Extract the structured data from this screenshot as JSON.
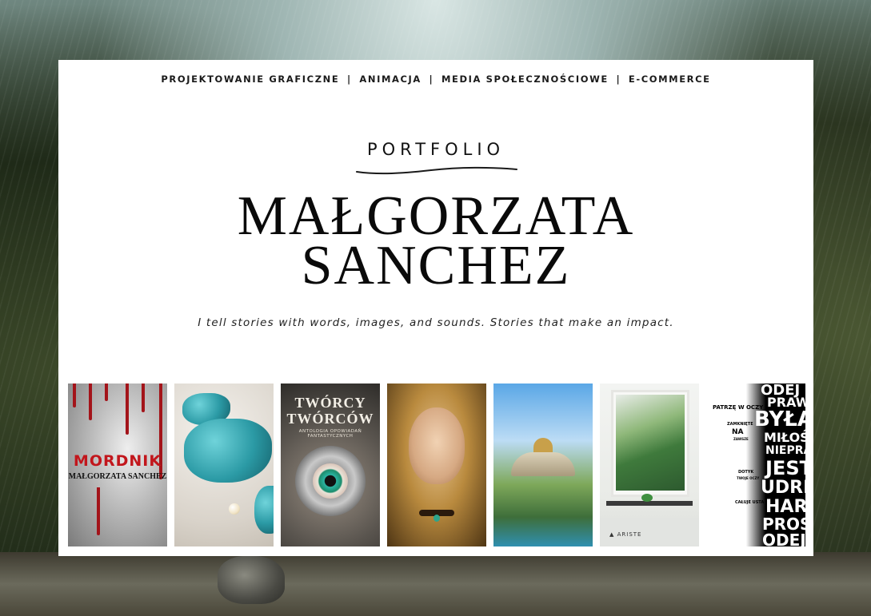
{
  "nav": {
    "items": [
      "PROJEKTOWANIE GRAFICZNE",
      "ANIMACJA",
      "MEDIA SPOŁECZNOŚCIOWE",
      "E-COMMERCE"
    ],
    "separator": "|"
  },
  "hero": {
    "kicker": "PORTFOLIO",
    "name_line1": "MAŁGORZATA",
    "name_line2": "SANCHEZ",
    "tagline": "I tell stories with words, images, and sounds. Stories that make an impact."
  },
  "thumbnails": {
    "mordnik": {
      "title": "MORDNIK",
      "author": "MAŁGORZATA SANCHEZ"
    },
    "tworcy": {
      "title_line1": "TWÓRCY",
      "title_line2": "TWÓRCÓW",
      "subtitle": "ANTOLOGIA OPOWIADAŃ FANTASTYCZNYCH"
    },
    "ariste": {
      "brand": "ARISTE"
    },
    "typography": {
      "words": [
        "ODEJ",
        "PRAWDZ",
        "BYŁA",
        "MIŁOŚ",
        "NIEPRAW",
        "JEST",
        "UDRE",
        "HAR",
        "PROS",
        "ODEJ"
      ],
      "side_words": [
        "PATRZĘ W OCZY",
        "ZAMKNIĘTE",
        "NA",
        "ZAWSZE",
        "DOTYK",
        "TWOJE OCZY",
        "CAŁUJE USTA"
      ]
    }
  },
  "colors": {
    "card_bg": "#ffffff",
    "text": "#0a0a0a",
    "blood_red": "#c2161c"
  }
}
